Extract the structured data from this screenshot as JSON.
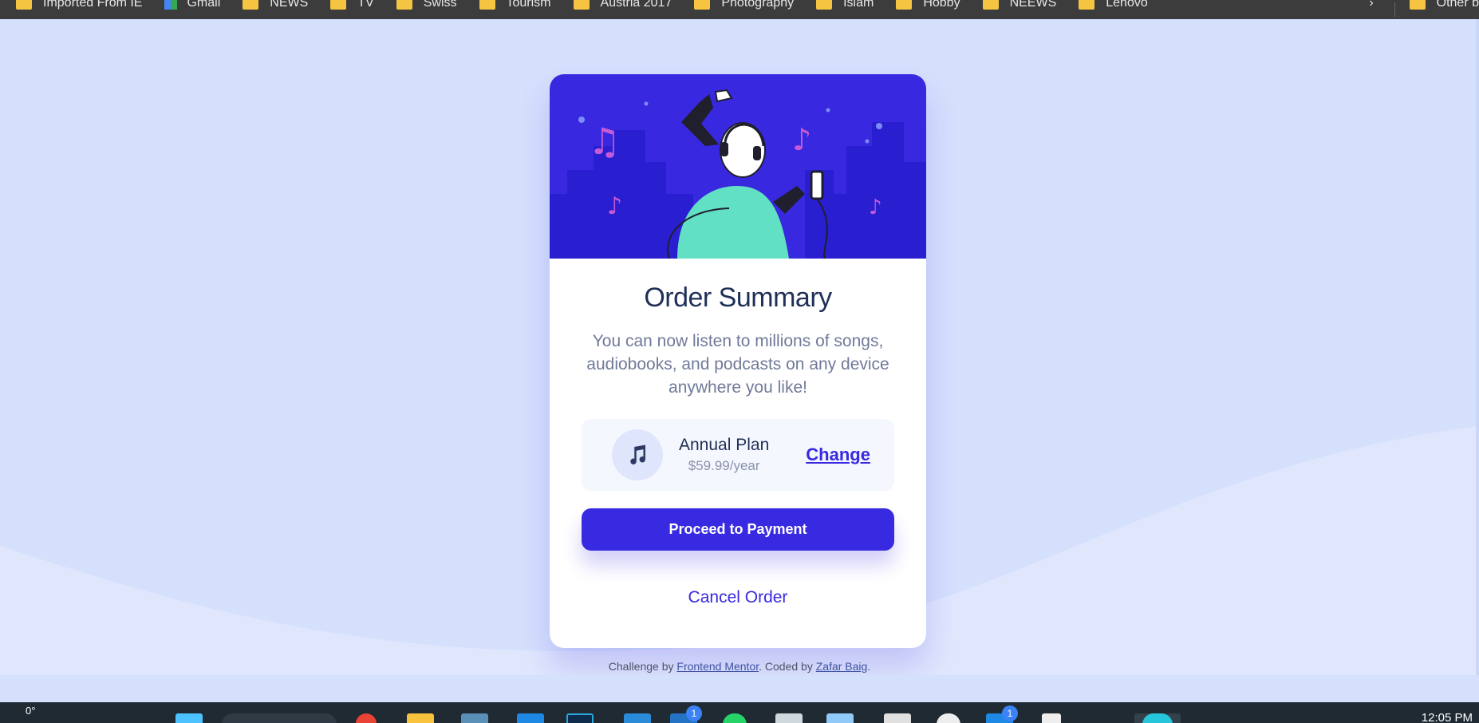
{
  "bookmarks": {
    "items": [
      {
        "label": "Imported From IE",
        "icon": "folder-icon"
      },
      {
        "label": "Gmail",
        "icon": "gmail-icon"
      },
      {
        "label": "NEWS",
        "icon": "folder-icon"
      },
      {
        "label": "TV",
        "icon": "folder-icon"
      },
      {
        "label": "Swiss",
        "icon": "folder-icon"
      },
      {
        "label": "Tourism",
        "icon": "folder-icon"
      },
      {
        "label": "Austria 2017",
        "icon": "folder-icon"
      },
      {
        "label": "Photography",
        "icon": "folder-icon"
      },
      {
        "label": "Islam",
        "icon": "folder-icon"
      },
      {
        "label": "Hobby",
        "icon": "folder-icon"
      },
      {
        "label": "NEEWS",
        "icon": "folder-icon"
      },
      {
        "label": "Lenovo",
        "icon": "folder-icon"
      }
    ],
    "overflow_glyph": "›",
    "other": "Other b"
  },
  "card": {
    "title": "Order Summary",
    "description": "You can now listen to millions of songs, audiobooks, and podcasts on any device anywhere you like!",
    "plan": {
      "icon": "music-note-icon",
      "name": "Annual Plan",
      "price": "$59.99/year",
      "change_label": "Change"
    },
    "pay_label": "Proceed to Payment",
    "cancel_label": "Cancel Order"
  },
  "attribution": {
    "prefix": "Challenge by ",
    "link1": "Frontend Mentor",
    "middle": ". Coded by ",
    "link2": "Zafar Baig",
    "suffix": "."
  },
  "taskbar": {
    "temperature": "0°",
    "badge1": "1",
    "badge2": "1",
    "clock": "12:05 PM"
  },
  "colors": {
    "page_bg": "#d5e0fd",
    "accent": "#382ae1",
    "title": "#1f2f56",
    "text_muted": "#707a99"
  }
}
